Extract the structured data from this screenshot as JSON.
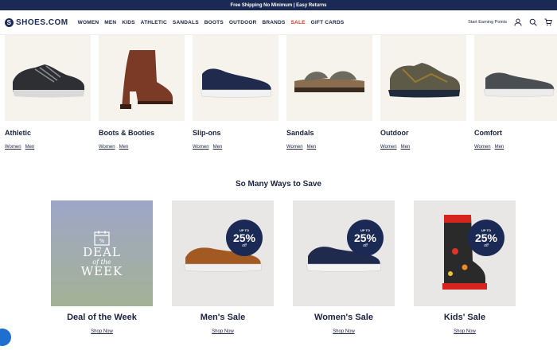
{
  "topbar": {
    "text": "Free Shipping No Minimum | Easy Returns"
  },
  "logo": {
    "mark": "S",
    "text": "SHOES.COM"
  },
  "nav": {
    "items": [
      "WOMEN",
      "MEN",
      "KIDS",
      "ATHLETIC",
      "SANDALS",
      "BOOTS",
      "OUTDOOR",
      "BRANDS",
      "SALE",
      "GIFT CARDS"
    ],
    "earning": "Start Earning Points"
  },
  "categories": [
    {
      "name": "Athletic",
      "women": "Women",
      "men": "Men",
      "shoe": "sneaker"
    },
    {
      "name": "Boots & Booties",
      "women": "Women",
      "men": "Men",
      "shoe": "boot"
    },
    {
      "name": "Slip-ons",
      "women": "Women",
      "men": "Men",
      "shoe": "slipon"
    },
    {
      "name": "Sandals",
      "women": "Women",
      "men": "Men",
      "shoe": "sandal"
    },
    {
      "name": "Outdoor",
      "women": "Women",
      "men": "Men",
      "shoe": "hiker"
    },
    {
      "name": "Comfort",
      "women": "Women",
      "men": "Men",
      "shoe": "comfort"
    }
  ],
  "save": {
    "title": "So Many Ways to Save",
    "deals": [
      {
        "name": "Deal of the Week",
        "link": "Shop Now",
        "week1": "DEAL",
        "week2": "of the",
        "week3": "WEEK"
      },
      {
        "name": "Men's Sale",
        "link": "Shop Now",
        "up": "UP TO",
        "pct": "25%",
        "off": "off"
      },
      {
        "name": "Women's Sale",
        "link": "Shop Now",
        "up": "UP TO",
        "pct": "25%",
        "off": "off"
      },
      {
        "name": "Kids' Sale",
        "link": "Shop Now",
        "up": "UP TO",
        "pct": "25%",
        "off": "off"
      }
    ]
  },
  "colors": {
    "navy": "#1b2a55",
    "sale": "#e0332c",
    "tile": "#f5f3ec"
  }
}
